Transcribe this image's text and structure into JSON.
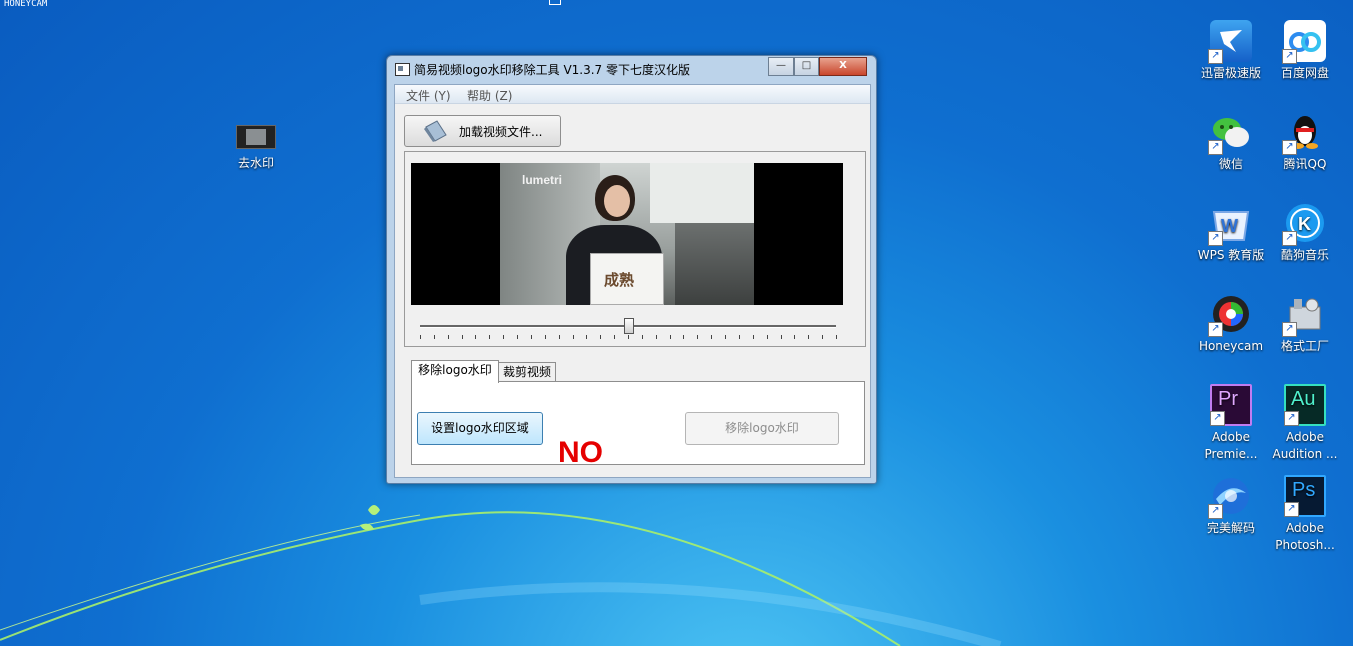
{
  "desktop": {
    "corner_label": "HONEYCAM",
    "icons": [
      {
        "label": "去水印",
        "icon": "video-thumbnail-icon"
      },
      {
        "label": "迅雷极速版",
        "icon": "thunder-icon"
      },
      {
        "label": "百度网盘",
        "icon": "baidu-netdisk-icon"
      },
      {
        "label": "微信",
        "icon": "wechat-icon"
      },
      {
        "label": "腾讯QQ",
        "icon": "qq-penguin-icon"
      },
      {
        "label": "WPS 教育版",
        "icon": "wps-icon"
      },
      {
        "label": "酷狗音乐",
        "icon": "kugou-icon"
      },
      {
        "label": "Honeycam",
        "icon": "honeycam-icon"
      },
      {
        "label": "格式工厂",
        "icon": "format-factory-icon"
      },
      {
        "label": "Adobe Premie...",
        "icon": "premiere-icon",
        "glyph": "Pr"
      },
      {
        "label": "Adobe Audition ...",
        "icon": "audition-icon",
        "glyph": "Au"
      },
      {
        "label": "完美解码",
        "icon": "potplayer-icon"
      },
      {
        "label": "Adobe Photosh...",
        "icon": "photoshop-icon",
        "glyph": "Ps"
      }
    ]
  },
  "window": {
    "title": "简易视频logo水印移除工具 V1.3.7 零下七度汉化版",
    "controls": {
      "minimize": "—",
      "maximize": "□",
      "close": "X"
    },
    "menu": [
      "文件 (Y)",
      "帮助 (Z)"
    ],
    "load_button": "加载视频文件...",
    "video": {
      "overlay_logo": "lumetri",
      "sign_text": "成熟"
    },
    "slider_position": 0.5,
    "tabs": [
      "移除logo水印",
      "裁剪视频"
    ],
    "active_tab": 0,
    "set_area_button": "设置logo水印区域",
    "annotation": "NO",
    "remove_button": "移除logo水印"
  },
  "colors": {
    "annotation": "#e50000",
    "desktop_blue": "#1a8fe0"
  }
}
